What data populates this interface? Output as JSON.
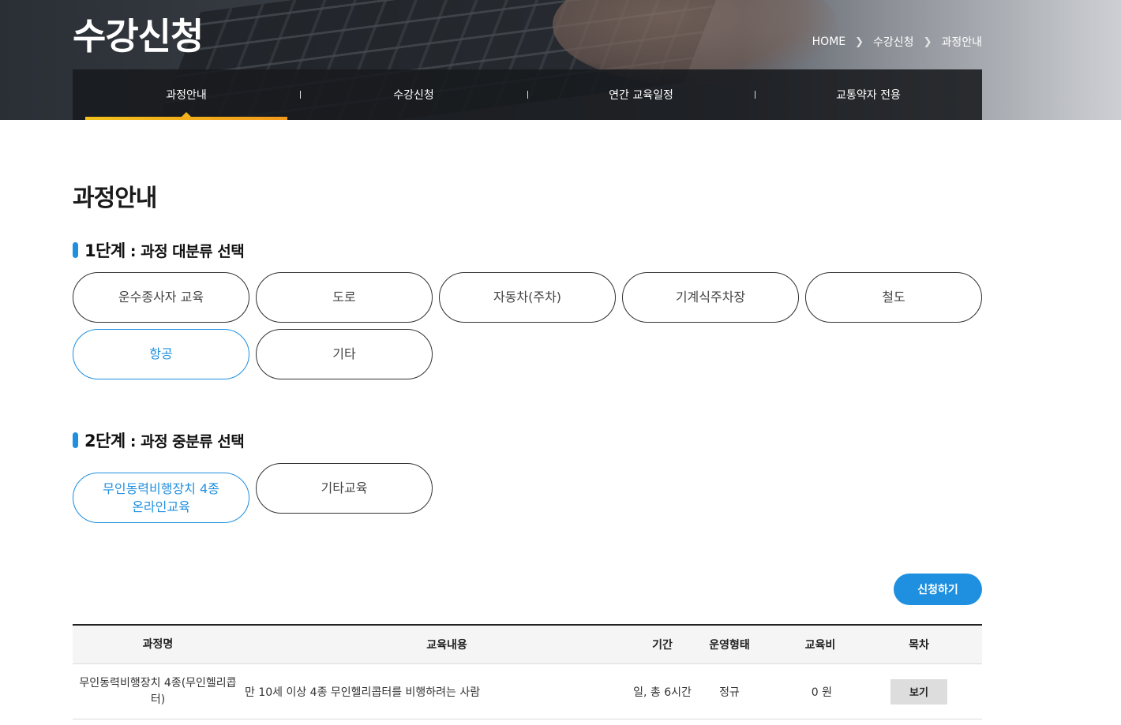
{
  "header": {
    "title": "수강신청",
    "breadcrumb": [
      "HOME",
      "수강신청",
      "과정안내"
    ],
    "tabs": [
      {
        "label": "과정안내",
        "active": true
      },
      {
        "label": "수강신청",
        "active": false
      },
      {
        "label": "연간 교육일정",
        "active": false
      },
      {
        "label": "교통약자 전용",
        "active": false
      }
    ]
  },
  "main": {
    "title": "과정안내",
    "step1": {
      "label": "1단계",
      "sub": " : 과정 대분류 선택",
      "options": [
        "운수종사자 교육",
        "도로",
        "자동차(주차)",
        "기계식주차장",
        "철도",
        "항공",
        "기타"
      ],
      "selected": "항공"
    },
    "step2": {
      "label": "2단계",
      "sub": " : 과정 중분류 선택",
      "options": [
        "무인동력비행장치 4종\n온라인교육",
        "기타교육"
      ],
      "selected": "무인동력비행장치 4종\n온라인교육"
    },
    "apply_label": "신청하기",
    "table": {
      "headers": [
        "과정명",
        "교육내용",
        "기간",
        "운영형태",
        "교육비",
        "목차"
      ],
      "rows": [
        {
          "name": "무인동력비행장치 4종(무인헬리콥터)",
          "content": "만 10세 이상 4종 무인헬리콥터를 비행하려는 사람",
          "period": "일, 총 6시간",
          "type": "정규",
          "fee": "0 원",
          "action": "보기"
        }
      ]
    }
  },
  "colors": {
    "accent": "#1f8fe0",
    "tab_indicator": "#f3b41b",
    "tab_bg": "#181a1e"
  }
}
